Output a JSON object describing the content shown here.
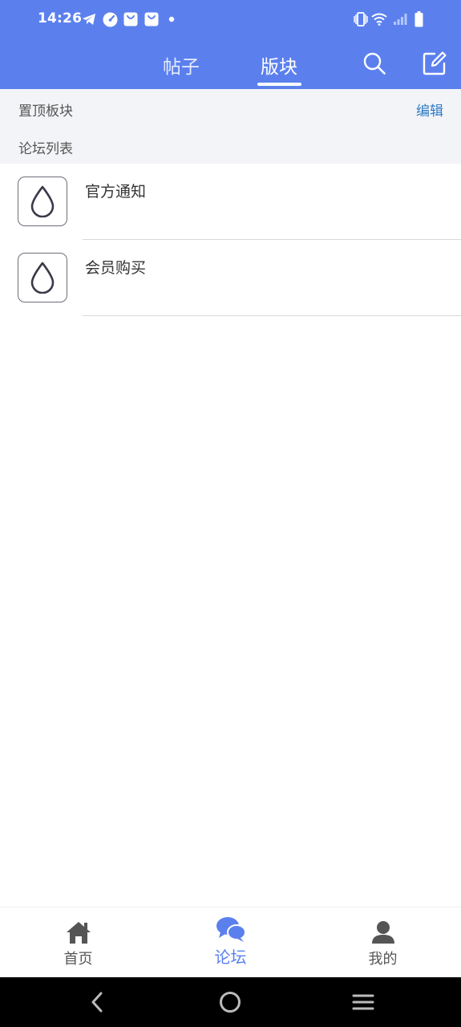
{
  "status_bar": {
    "time": "14:26",
    "icons": [
      "telegram-icon",
      "speedometer-icon",
      "shopping-bag-icon",
      "shopping-bag-icon",
      "dot-icon",
      "vibrate-icon",
      "wifi-icon",
      "signal-icon",
      "battery-icon"
    ]
  },
  "app_bar": {
    "tabs": [
      {
        "label": "帖子",
        "active": false
      },
      {
        "label": "版块",
        "active": true
      }
    ],
    "actions": [
      "search-icon",
      "edit-icon"
    ]
  },
  "pinned_section": {
    "label": "置顶板块",
    "edit_label": "编辑"
  },
  "forum_section": {
    "label": "论坛列表"
  },
  "forums": [
    {
      "name": "官方通知",
      "icon": "droplet-icon"
    },
    {
      "name": "会员购买",
      "icon": "droplet-icon"
    }
  ],
  "bottom_nav": {
    "items": [
      {
        "label": "首页",
        "icon": "home-icon",
        "active": false
      },
      {
        "label": "论坛",
        "icon": "chat-bubbles-icon",
        "active": true
      },
      {
        "label": "我的",
        "icon": "person-icon",
        "active": false
      }
    ]
  },
  "system_nav": [
    "back-icon",
    "home-circle-icon",
    "recents-icon"
  ],
  "colors": {
    "primary": "#5b80ee",
    "link": "#2f7cc4",
    "section_bg": "#f3f4f7",
    "text": "#333333"
  }
}
